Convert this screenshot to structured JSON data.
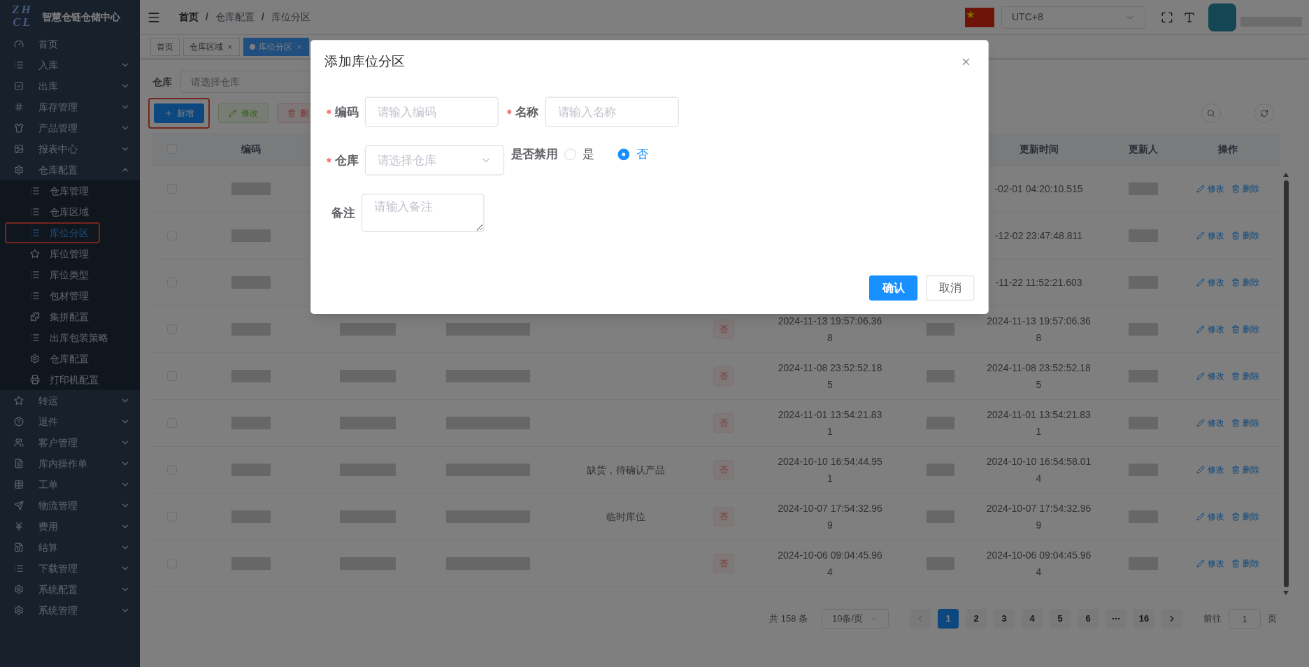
{
  "brand": {
    "logo_lines": [
      "ZH",
      "CL"
    ],
    "title": "智慧仓链仓储中心"
  },
  "sidebar": [
    {
      "label": "首页",
      "kind": "link"
    },
    {
      "label": "入库",
      "kind": "group",
      "expanded": false
    },
    {
      "label": "出库",
      "kind": "group",
      "expanded": false
    },
    {
      "label": "库存管理",
      "kind": "group",
      "expanded": false
    },
    {
      "label": "产品管理",
      "kind": "group",
      "expanded": false
    },
    {
      "label": "报表中心",
      "kind": "group",
      "expanded": false
    },
    {
      "label": "仓库配置",
      "kind": "group",
      "expanded": true,
      "children": [
        {
          "label": "仓库管理",
          "selected": false,
          "annotated": false
        },
        {
          "label": "仓库区域",
          "selected": false,
          "annotated": false
        },
        {
          "label": "库位分区",
          "selected": true,
          "annotated": true
        },
        {
          "label": "库位管理",
          "selected": false,
          "annotated": false
        },
        {
          "label": "库位类型",
          "selected": false,
          "annotated": false
        },
        {
          "label": "包材管理",
          "selected": false,
          "annotated": false
        },
        {
          "label": "集拼配置",
          "selected": false,
          "annotated": false
        },
        {
          "label": "出库包装策略",
          "selected": false,
          "annotated": false
        },
        {
          "label": "仓库配置",
          "selected": false,
          "annotated": false
        },
        {
          "label": "打印机配置",
          "selected": false,
          "annotated": false
        }
      ]
    },
    {
      "label": "转运",
      "kind": "group",
      "expanded": false
    },
    {
      "label": "退件",
      "kind": "group",
      "expanded": false
    },
    {
      "label": "客户管理",
      "kind": "group",
      "expanded": false
    },
    {
      "label": "库内操作单",
      "kind": "group",
      "expanded": false
    },
    {
      "label": "工单",
      "kind": "group",
      "expanded": false
    },
    {
      "label": "物流管理",
      "kind": "group",
      "expanded": false
    },
    {
      "label": "费用",
      "kind": "group",
      "expanded": false
    },
    {
      "label": "结算",
      "kind": "group",
      "expanded": false
    },
    {
      "label": "下载管理",
      "kind": "group",
      "expanded": false
    },
    {
      "label": "系统配置",
      "kind": "group",
      "expanded": false
    },
    {
      "label": "系统管理",
      "kind": "group",
      "expanded": false
    }
  ],
  "header": {
    "breadcrumb": [
      {
        "kind": "link",
        "text": "首页"
      },
      {
        "kind": "separator",
        "text": "/"
      },
      {
        "kind": "link",
        "text": "仓库配置"
      },
      {
        "kind": "separator",
        "text": "/"
      },
      {
        "kind": "current",
        "text": "库位分区"
      }
    ],
    "timezone": "UTC+8"
  },
  "tabs": [
    {
      "label": "首页",
      "selected": false,
      "closable": false
    },
    {
      "label": "仓库区域",
      "selected": false,
      "closable": true
    },
    {
      "label": "库位分区",
      "selected": true,
      "closable": true
    }
  ],
  "filter": {
    "label": "仓库",
    "placeholder": "请选择仓库"
  },
  "toolbar": [
    {
      "kind": "add",
      "label": "新增",
      "annotated": true
    },
    {
      "kind": "edit",
      "label": "修改",
      "annotated": false
    },
    {
      "kind": "delete",
      "label": "删",
      "annotated": false
    }
  ],
  "table": {
    "select_all_checked": false,
    "headers": {
      "code": "编码",
      "updated_at": "更新时间",
      "updated_by": "更新人",
      "actions": "操作"
    },
    "rows": [
      {
        "checked": false,
        "updated_at": "-02-01 04:20:10.515",
        "edit": "修改",
        "delete": "删除"
      },
      {
        "checked": false,
        "updated_at": "-12-02 23:47:48.811",
        "edit": "修改",
        "delete": "删除"
      },
      {
        "checked": false,
        "updated_at": "-11-22 11:52:21.603",
        "edit": "修改",
        "delete": "删除"
      },
      {
        "checked": false,
        "disabled": "否",
        "created_at": "2024-11-13 19:57:06.368",
        "updated_at": "2024-11-13 19:57:06.368",
        "edit": "修改",
        "delete": "删除"
      },
      {
        "checked": false,
        "disabled": "否",
        "created_at": "2024-11-08 23:52:52.185",
        "updated_at": "2024-11-08 23:52:52.185",
        "edit": "修改",
        "delete": "删除"
      },
      {
        "checked": false,
        "disabled": "否",
        "created_at": "2024-11-01 13:54:21.831",
        "updated_at": "2024-11-01 13:54:21.831",
        "edit": "修改",
        "delete": "删除"
      },
      {
        "checked": false,
        "note": "缺货，待确认产品",
        "disabled": "否",
        "created_at": "2024-10-10 16:54:44.951",
        "updated_at": "2024-10-10 16:54:58.014",
        "edit": "修改",
        "delete": "删除"
      },
      {
        "checked": false,
        "note": "临时库位",
        "disabled": "否",
        "created_at": "2024-10-07 17:54:32.969",
        "updated_at": "2024-10-07 17:54:32.969",
        "edit": "修改",
        "delete": "删除"
      },
      {
        "checked": false,
        "disabled": "否",
        "created_at": "2024-10-06 09:04:45.964",
        "updated_at": "2024-10-06 09:04:45.964",
        "edit": "修改",
        "delete": "删除"
      }
    ]
  },
  "pagination": {
    "total": "共 158 条",
    "page_size": "10条/页",
    "prev_disabled": true,
    "next_disabled": false,
    "pages": [
      {
        "label": "1",
        "selected": true
      },
      {
        "label": "2",
        "selected": false
      },
      {
        "label": "3",
        "selected": false
      },
      {
        "label": "4",
        "selected": false
      },
      {
        "label": "5",
        "selected": false
      },
      {
        "label": "6",
        "selected": false
      },
      {
        "kind": "ellipsis",
        "selected": false
      },
      {
        "label": "16",
        "selected": false
      }
    ],
    "goto_label": "前往",
    "goto_value": "1",
    "goto_suffix": "页"
  },
  "modal": {
    "title": "添加库位分区",
    "rows": [
      [
        {
          "kind": "input",
          "label": "编码",
          "required": true,
          "placeholder": "请输入编码"
        },
        {
          "kind": "input",
          "label": "名称",
          "required": true,
          "placeholder": "请输入名称"
        }
      ],
      [
        {
          "kind": "select",
          "label": "仓库",
          "required": true,
          "placeholder": "请选择仓库"
        },
        {
          "kind": "radio",
          "label": "是否禁用",
          "required": false,
          "options": [
            {
              "label": "是",
              "selected": false
            },
            {
              "label": "否",
              "selected": true
            }
          ]
        }
      ],
      [
        {
          "kind": "textarea",
          "label": "备注",
          "required": false,
          "placeholder": "请输入备注"
        }
      ]
    ],
    "buttons": [
      {
        "kind": "primary",
        "label": "确认"
      },
      {
        "kind": "default",
        "label": "取消"
      }
    ]
  }
}
